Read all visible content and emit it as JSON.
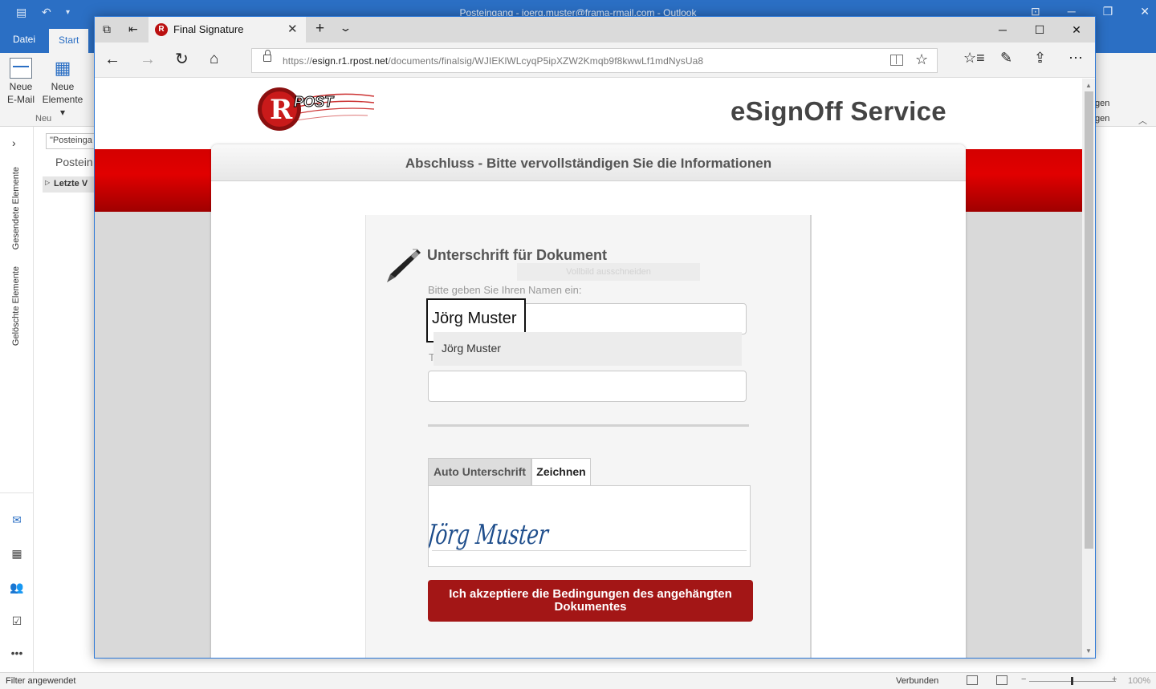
{
  "outlook": {
    "window_title": "Posteingang - joerg.muster@frama-rmail.com  -  Outlook",
    "tabs": {
      "file": "Datei",
      "start": "Start"
    },
    "ribbon": {
      "new_email_line1": "Neue",
      "new_email_line2": "E-Mail",
      "new_items_line1": "Neue",
      "new_items_line2": "Elemente ▾",
      "group_label": "Neu",
      "right_partial_1": "gen",
      "right_partial_2": "gen"
    },
    "left_rail": {
      "sent_items": "Gesendete Elemente",
      "deleted_items": "Gelöschte Elemente"
    },
    "folder_pane": {
      "search_placeholder": "\"Posteinga",
      "inbox_label": "Postein",
      "group_label": "Letzte V"
    },
    "statusbar": {
      "filter": "Filter angewendet",
      "connection": "Verbunden",
      "zoom": "100%"
    }
  },
  "browser": {
    "tab_title": "Final Signature",
    "url_scheme": "https://",
    "url_host": "esign.r1.rpost.net",
    "url_path": "/documents/finalsig/WJIEKlWLcyqP5ipXZW2Kmqb9f8kwwLf1mdNysUa8"
  },
  "page": {
    "logo_text": "POST",
    "service_title": "eSignOff Service",
    "panel_heading": "Abschluss - Bitte vervollständigen Sie die Informationen",
    "section_title": "Unterschrift für Dokument",
    "ghost_text": "Vollbild ausschneiden",
    "name_label": "Bitte geben Sie Ihren Namen ein:",
    "name_value": "Jörg Muster",
    "autocomplete_suggestion": "Jörg Muster",
    "title_label_fragment": "T",
    "tab_auto": "Auto Unterschrift",
    "tab_draw": "Zeichnen",
    "signature_text": "Jörg Muster",
    "accept_button": "Ich akzeptiere die Bedingungen des angehängten Dokumentes"
  },
  "colors": {
    "outlook_blue": "#2b6fc4",
    "rpost_red": "#d40000",
    "accept_red": "#a31616",
    "signature_ink": "#1f4e8c"
  }
}
